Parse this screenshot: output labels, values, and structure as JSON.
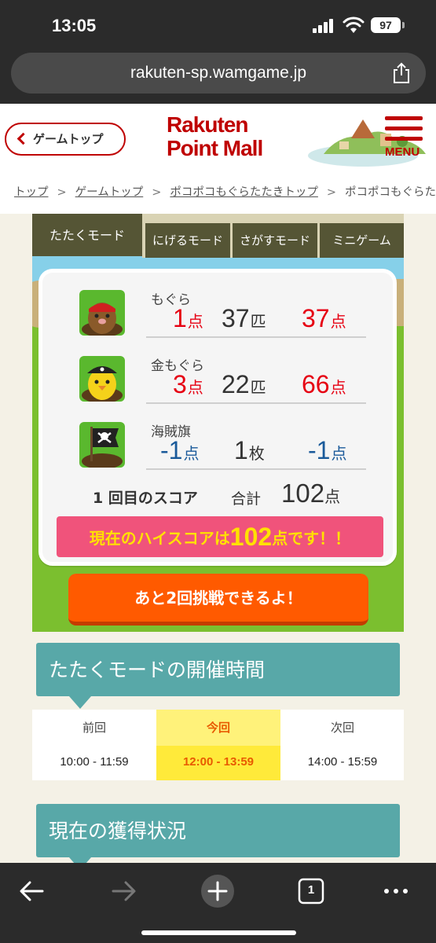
{
  "status_bar": {
    "time": "13:05",
    "battery": "97"
  },
  "browser": {
    "url": "rakuten-sp.wamgame.jp"
  },
  "header": {
    "back_button": "ゲームトップ",
    "logo_line1": "Rakuten",
    "logo_line2": "Point Mall",
    "menu_label": "MENU",
    "brand_color": "#bf0000"
  },
  "breadcrumb": [
    "トップ",
    "ゲームトップ",
    "ポコポコもぐらたたきトップ",
    "ポコポコもぐらた"
  ],
  "mode_tabs": [
    "たたくモード",
    "にげるモード",
    "さがすモード",
    "ミニゲーム"
  ],
  "results": [
    {
      "name": "もぐら",
      "icon": "mole-icon",
      "points": "1",
      "count": "37",
      "count_unit": "匹",
      "total": "37",
      "unit": "点",
      "color": "red"
    },
    {
      "name": "金もぐら",
      "icon": "gold-mole-icon",
      "points": "3",
      "count": "22",
      "count_unit": "匹",
      "total": "66",
      "unit": "点",
      "color": "red"
    },
    {
      "name": "海賊旗",
      "icon": "pirate-flag-icon",
      "points": "-1",
      "count": "1",
      "count_unit": "枚",
      "total": "-1",
      "unit": "点",
      "color": "blue"
    }
  ],
  "score": {
    "label": "1 回目のスコア",
    "total_label": "合計",
    "total": "102",
    "unit": "点"
  },
  "high_score": {
    "prefix": "現在のハイスコアは",
    "value": "102",
    "suffix": "点です！！"
  },
  "challenge_button": "あと2回挑戦できるよ！",
  "schedule": {
    "title": "たたくモードの開催時間",
    "columns": [
      {
        "label": "前回",
        "time": "10:00 - 11:59"
      },
      {
        "label": "今回",
        "time": "12:00 - 13:59"
      },
      {
        "label": "次回",
        "time": "14:00 - 15:59"
      }
    ]
  },
  "status_section": {
    "title": "現在の獲得状況"
  },
  "tab_count": "1"
}
